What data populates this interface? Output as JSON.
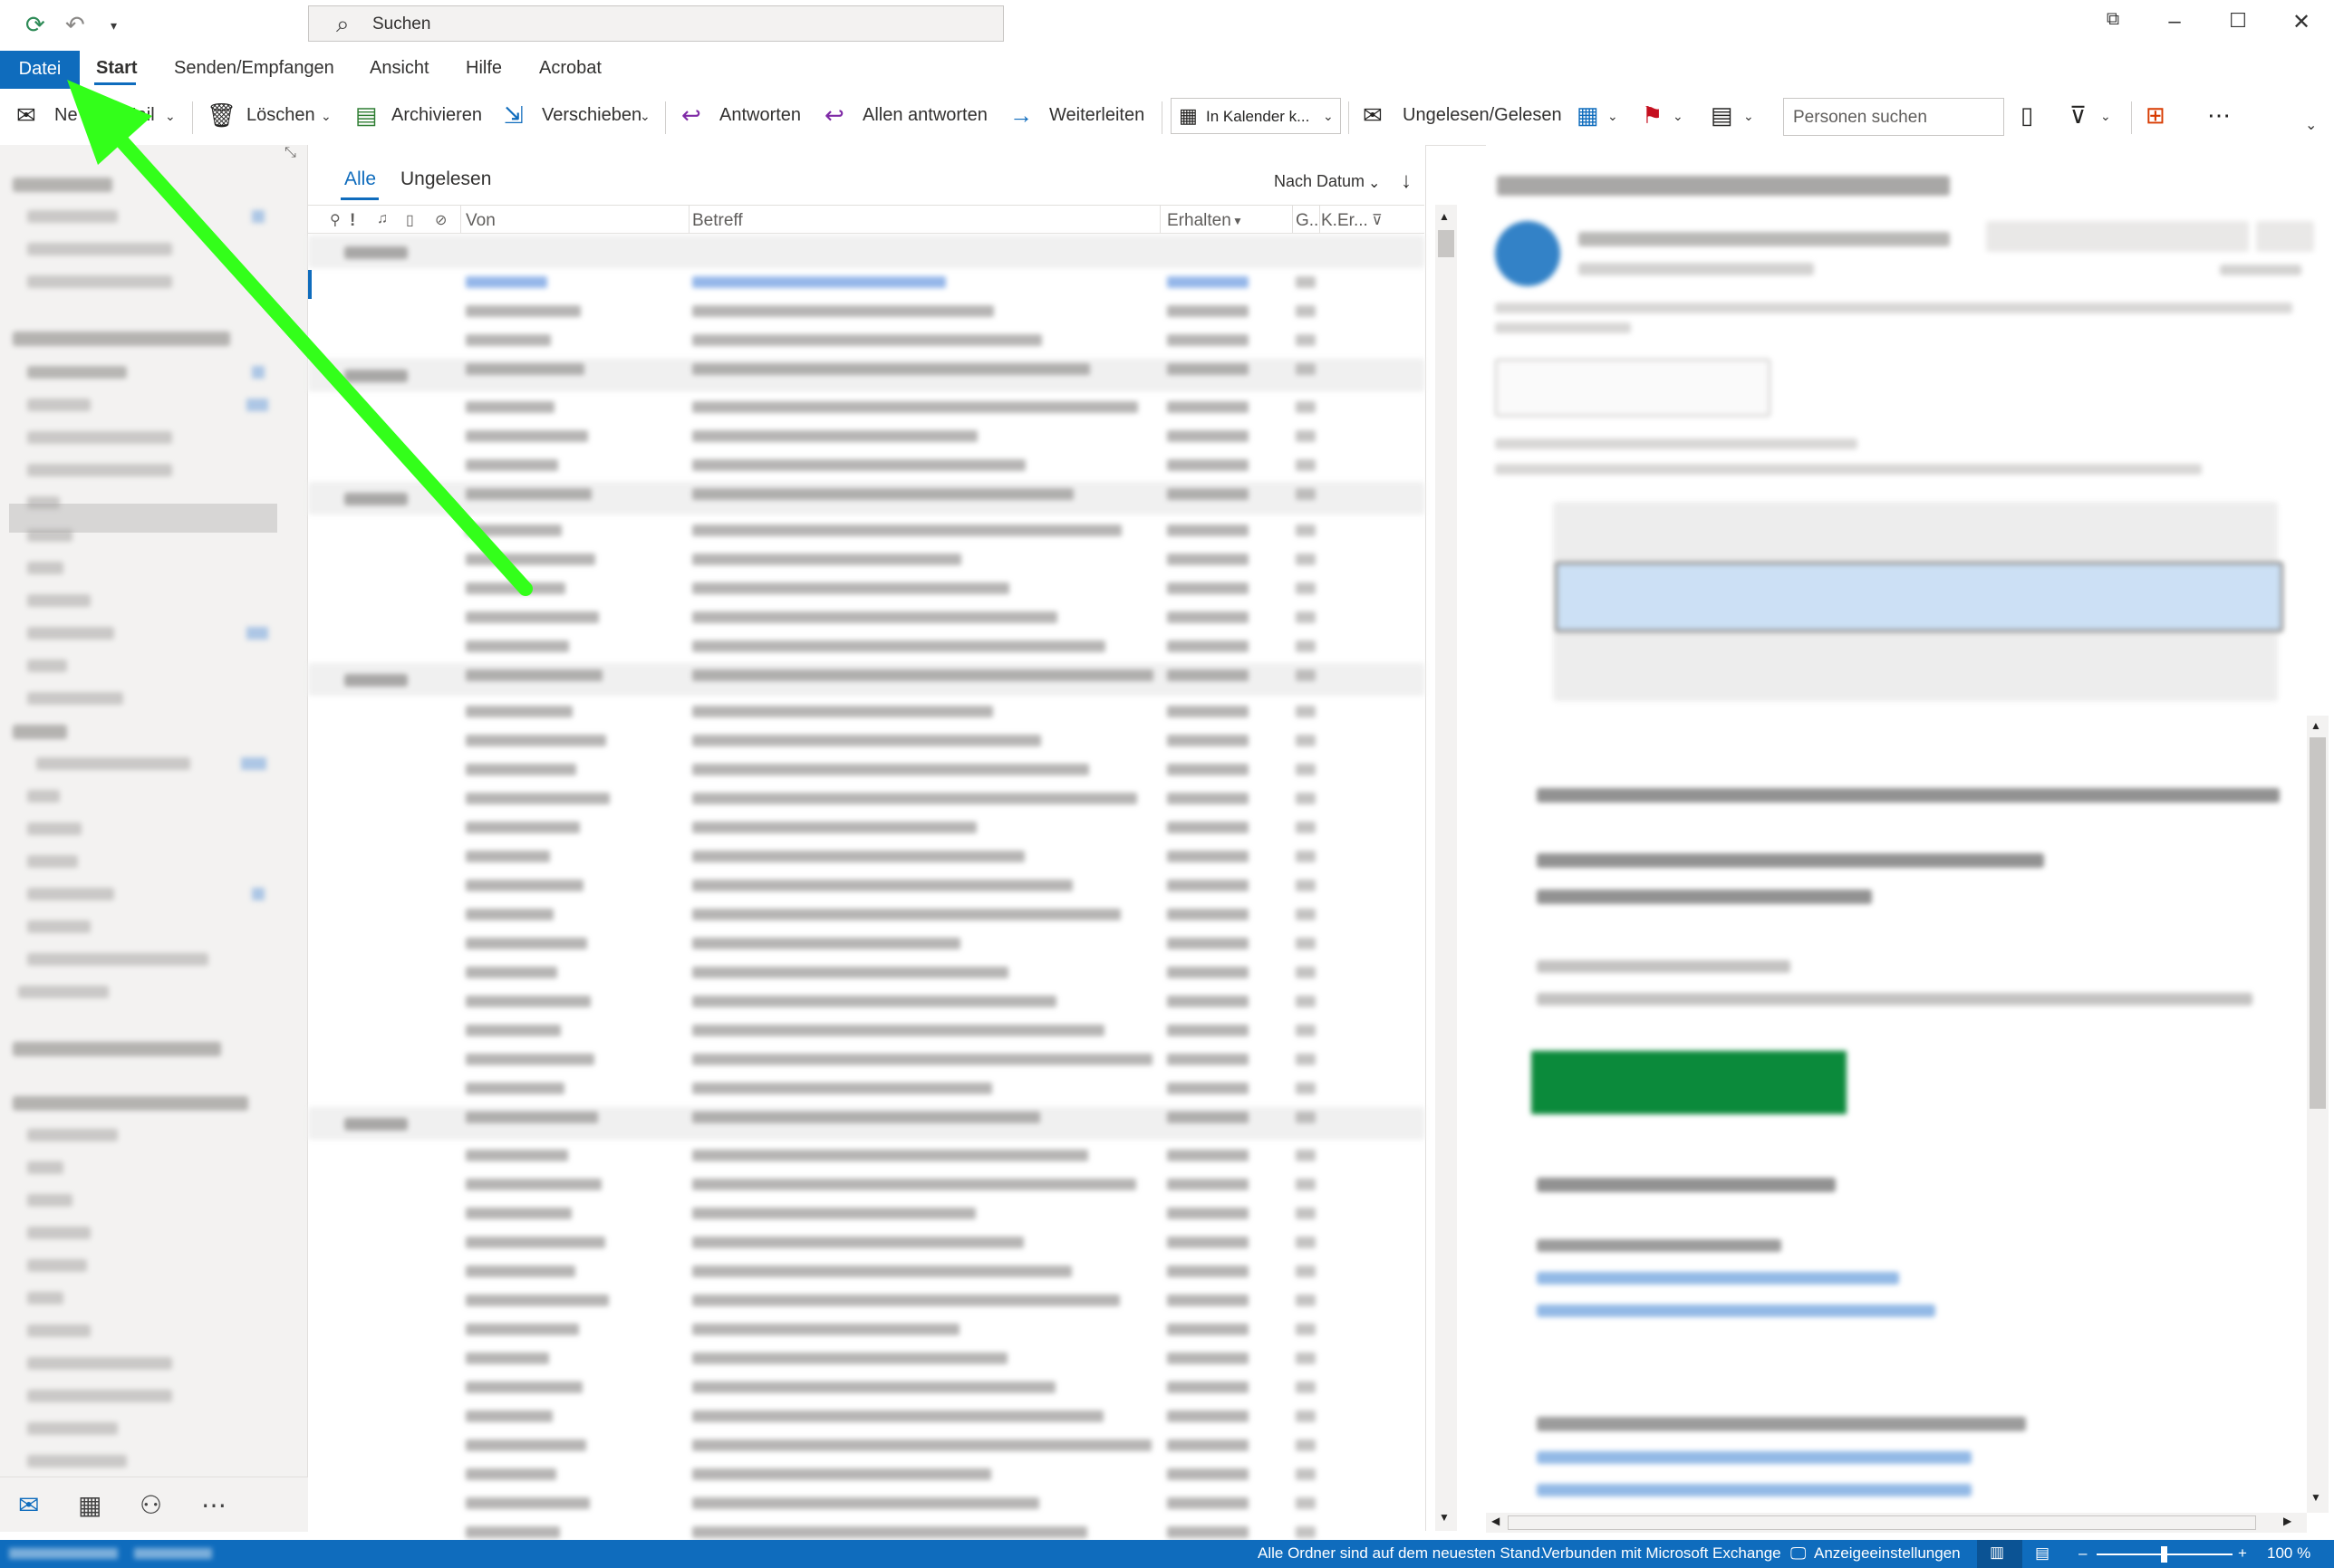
{
  "titlebar": {
    "search_placeholder": "Suchen",
    "icons": [
      "sync-icon",
      "undo-icon",
      "quick-access-dropdown-icon",
      "search-icon",
      "ribbon-display-icon",
      "minimize-icon",
      "maximize-icon",
      "close-icon"
    ]
  },
  "menu": {
    "datei": "Datei",
    "start": "Start",
    "senden": "Senden/Empfangen",
    "ansicht": "Ansicht",
    "hilfe": "Hilfe",
    "acrobat": "Acrobat"
  },
  "ribbon": {
    "new_mail": "Neue E-Mail",
    "new_mail_visible_1": "Ne",
    "new_mail_visible_2": "Mail",
    "delete": "Löschen",
    "archive": "Archivieren",
    "move": "Verschieben",
    "reply": "Antworten",
    "reply_all": "Allen antworten",
    "forward": "Weiterleiten",
    "calendar": "In Kalender k...",
    "unread_read": "Ungelesen/Gelesen",
    "people_search": "Personen suchen"
  },
  "list": {
    "tab_all": "Alle",
    "tab_unread": "Ungelesen",
    "sort": "Nach Datum",
    "col_from": "Von",
    "col_subject": "Betreff",
    "col_received": "Erhalten",
    "col_g": "G..",
    "col_k": "K..",
    "col_er": "Er..."
  },
  "status": {
    "folders_uptodate": "Alle Ordner sind auf dem neuesten Stand.",
    "connected": "Verbunden mit Microsoft Exchange",
    "display_settings": "Anzeigeeinstellungen",
    "zoom": "100 %"
  },
  "colors": {
    "accent": "#0f6cbd",
    "arrow": "#33ff1a",
    "join_button": "#0b8a3b"
  }
}
